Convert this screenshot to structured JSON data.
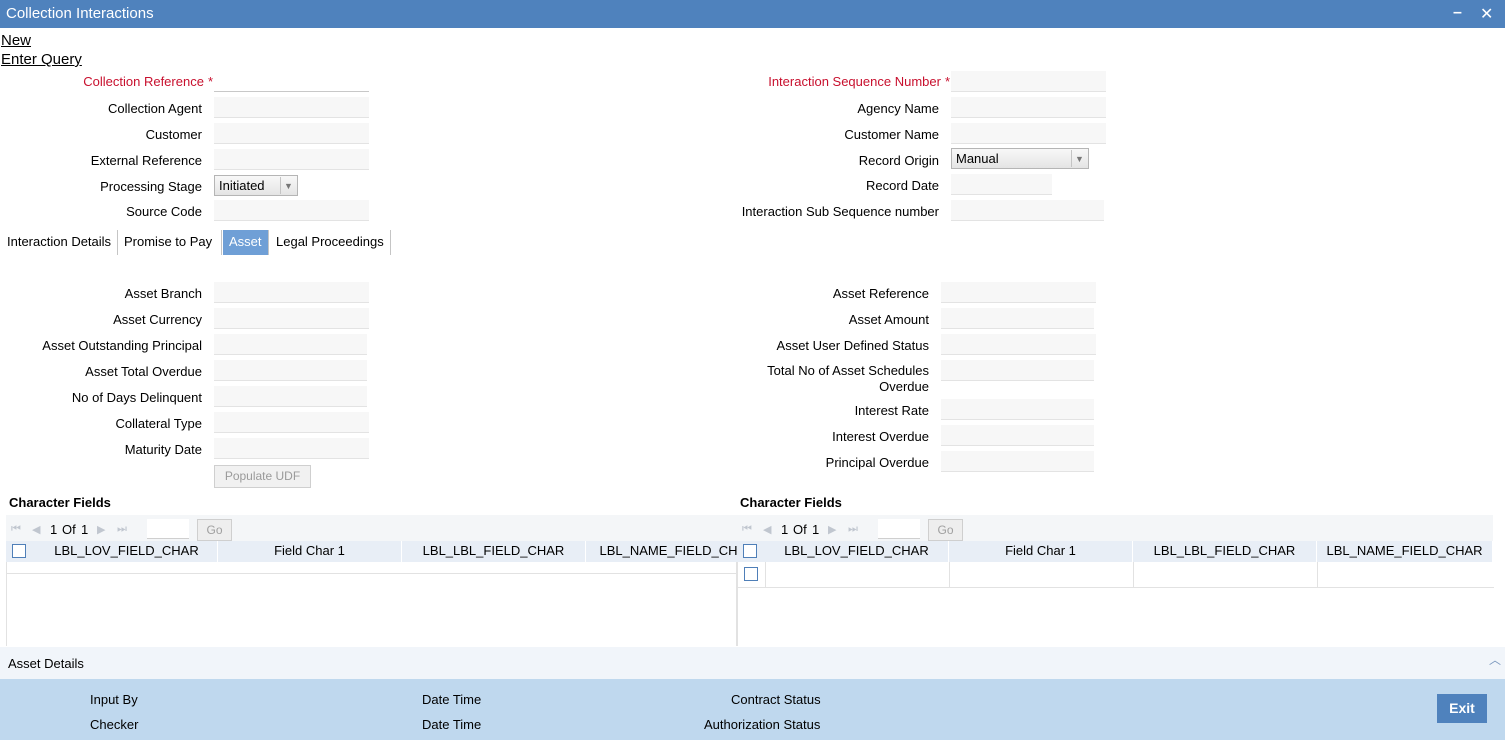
{
  "window": {
    "title": "Collection Interactions",
    "minimize_icon": "minimize-icon",
    "close_icon": "close-icon"
  },
  "menu": {
    "new": "New",
    "enter_query": "Enter Query"
  },
  "header": {
    "collection_reference": "Collection Reference",
    "collection_agent": "Collection Agent",
    "customer": "Customer",
    "external_reference": "External Reference",
    "processing_stage": "Processing Stage",
    "processing_stage_value": "Initiated",
    "source_code": "Source Code",
    "interaction_sequence_number": "Interaction Sequence Number",
    "agency_name": "Agency Name",
    "customer_name": "Customer Name",
    "record_origin": "Record Origin",
    "record_origin_value": "Manual",
    "record_date": "Record Date",
    "interaction_sub_sequence_number": "Interaction Sub Sequence number",
    "required_mark": "*"
  },
  "tabs": [
    "Interaction Details",
    "Promise to Pay",
    "Asset",
    "Legal Proceedings"
  ],
  "asset": {
    "asset_branch": "Asset Branch",
    "asset_currency": "Asset Currency",
    "asset_outstanding_principal": "Asset Outstanding Principal",
    "asset_total_overdue": "Asset Total Overdue",
    "no_of_days_delinquent": "No of Days Delinquent",
    "collateral_type": "Collateral Type",
    "maturity_date": "Maturity Date",
    "populate_udf": "Populate UDF",
    "asset_reference": "Asset Reference",
    "asset_amount": "Asset Amount",
    "asset_user_defined_status": "Asset User Defined Status",
    "total_no_of_asset_schedules_overdue": "Total No of Asset Schedules Overdue",
    "interest_rate": "Interest Rate",
    "interest_overdue": "Interest Overdue",
    "principal_overdue": "Principal Overdue"
  },
  "grids": [
    {
      "title": "Character Fields",
      "page": "1",
      "of": "Of",
      "total": "1",
      "go": "Go",
      "columns": [
        "LBL_LOV_FIELD_CHAR",
        "Field Char 1",
        "LBL_LBL_FIELD_CHAR",
        "LBL_NAME_FIELD_CHAR"
      ]
    },
    {
      "title": "Character Fields",
      "page": "1",
      "of": "Of",
      "total": "1",
      "go": "Go",
      "columns": [
        "LBL_LOV_FIELD_CHAR",
        "Field Char 1",
        "LBL_LBL_FIELD_CHAR",
        "LBL_NAME_FIELD_CHAR"
      ]
    }
  ],
  "asset_details": {
    "title": "Asset Details"
  },
  "footer": {
    "input_by": "Input By",
    "checker": "Checker",
    "date_time_1": "Date Time",
    "date_time_2": "Date Time",
    "contract_status": "Contract Status",
    "authorization_status": "Authorization Status",
    "exit": "Exit"
  },
  "colors": {
    "title_bar": "#4f82bd",
    "active_tab": "#6f9fd6",
    "footer": "#bfd8ee",
    "required": "#c8102e"
  }
}
